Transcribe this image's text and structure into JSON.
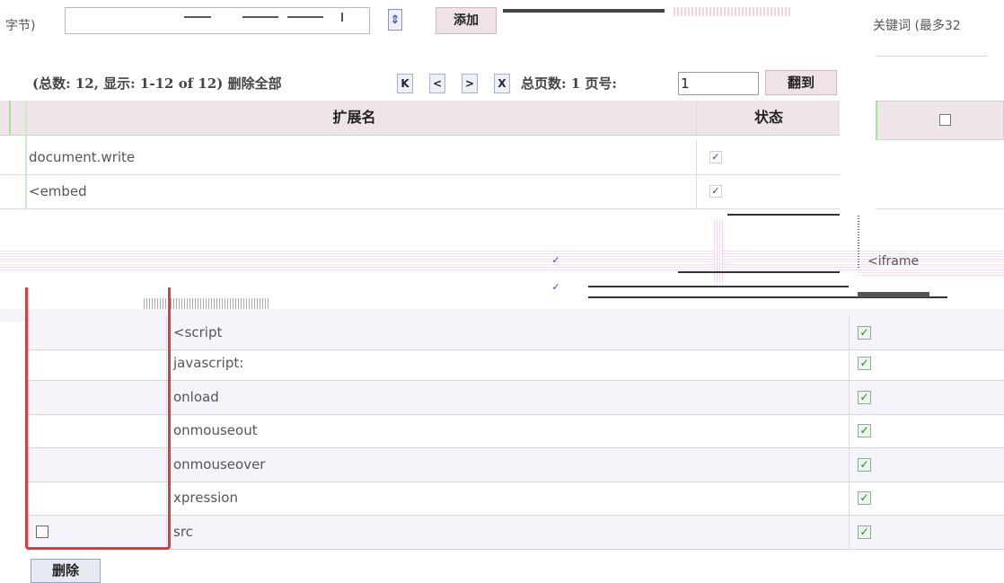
{
  "top": {
    "left_label": "字节)",
    "add_label": "添加",
    "right_label": "关键词 (最多32"
  },
  "pager": {
    "summary": "(总数: 12, 显示: 1-12 of 12) 删除全部",
    "first": "K",
    "prev": "<",
    "next": ">",
    "last": "X",
    "total_pages": "总页数: 1  页号:",
    "page_value": "1",
    "goto_label": "翻到"
  },
  "table": {
    "col_ext": "扩展名",
    "col_status": "状态",
    "rows_upper": [
      {
        "ext": "document.write",
        "checked": true
      },
      {
        "ext": "<embed",
        "checked": true
      }
    ],
    "glitch_items": [
      "<iframe",
      "<script"
    ],
    "rows_lower": [
      {
        "ext": "javascript:",
        "checked": true
      },
      {
        "ext": "onload",
        "checked": true
      },
      {
        "ext": "onmouseout",
        "checked": true
      },
      {
        "ext": "onmouseover",
        "checked": true
      },
      {
        "ext": "xpression",
        "checked": true
      },
      {
        "ext": "src",
        "checked": true
      }
    ]
  },
  "actions": {
    "delete_label": "删除"
  },
  "icons": {
    "check": "✓",
    "select_arrow": "⇕"
  },
  "colors": {
    "header_bg": "#efe5e8",
    "red_highlight": "#e03b3b",
    "check_blue": "#3a3ac0",
    "check_green": "#2c7a2c"
  }
}
